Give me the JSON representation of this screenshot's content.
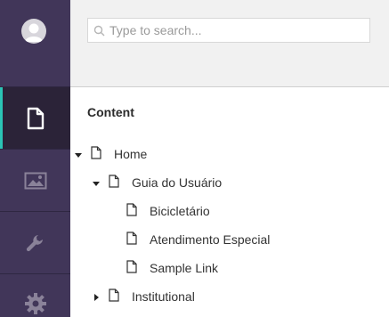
{
  "sidebar": {
    "avatar_icon": "user-avatar-icon",
    "items": [
      {
        "icon": "content-document-icon",
        "active": true
      },
      {
        "icon": "media-image-icon",
        "active": false
      },
      {
        "icon": "wrench-settings-icon",
        "active": false
      },
      {
        "icon": "gear-icon",
        "active": false
      }
    ],
    "colors": {
      "background": "#413659",
      "active_background": "#2b2338",
      "active_indicator": "#2bc4b5"
    }
  },
  "search": {
    "placeholder": "Type to search...",
    "value": ""
  },
  "content": {
    "title": "Content",
    "tree": [
      {
        "label": "Home",
        "expanded": true
      },
      {
        "label": "Guia do Usuário",
        "expanded": true
      },
      {
        "label": "Bicicletário"
      },
      {
        "label": "Atendimento Especial"
      },
      {
        "label": "Sample Link"
      },
      {
        "label": "Institutional",
        "expanded": false
      }
    ]
  }
}
